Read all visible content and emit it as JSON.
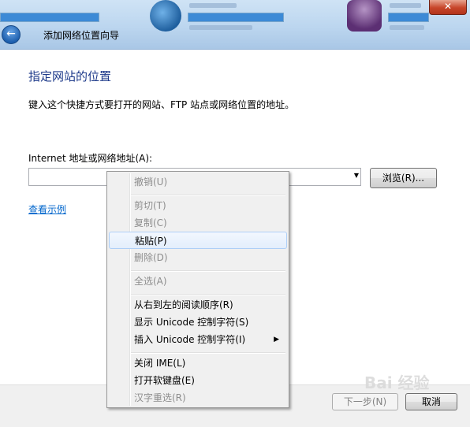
{
  "window": {
    "title": "添加网络位置向导",
    "close_glyph": "✕"
  },
  "nav": {
    "back_glyph": "←"
  },
  "main": {
    "heading": "指定网站的位置",
    "description": "键入这个快捷方式要打开的网站、FTP 站点或网络位置的地址。",
    "address_label": "Internet 地址或网络地址(A):",
    "address_value": "",
    "combo_arrow_glyph": "▼",
    "browse_label": "浏览(R)...",
    "examples_link": "查看示例"
  },
  "footer": {
    "next_label": "下一步(N)",
    "cancel_label": "取消"
  },
  "context_menu": {
    "items": [
      {
        "label": "撤销(U)",
        "enabled": false
      },
      {
        "label": "剪切(T)",
        "enabled": false
      },
      {
        "label": "复制(C)",
        "enabled": false
      },
      {
        "label": "粘贴(P)",
        "enabled": true,
        "highlighted": true
      },
      {
        "label": "删除(D)",
        "enabled": false
      },
      {
        "label": "全选(A)",
        "enabled": false
      },
      {
        "label": "从右到左的阅读顺序(R)",
        "enabled": true
      },
      {
        "label": "显示 Unicode 控制字符(S)",
        "enabled": true
      },
      {
        "label": "插入 Unicode 控制字符(I)",
        "enabled": true,
        "submenu": true
      },
      {
        "label": "关闭 IME(L)",
        "enabled": true
      },
      {
        "label": "打开软键盘(E)",
        "enabled": true
      },
      {
        "label": "汉字重选(R)",
        "enabled": false
      }
    ],
    "submenu_glyph": "▶"
  },
  "watermark": "Bai 经验",
  "colors": {
    "heading": "#1e3a8a",
    "link": "#0066cc",
    "close_button": "#c7452a",
    "menu_highlight": "#e3eefc"
  }
}
